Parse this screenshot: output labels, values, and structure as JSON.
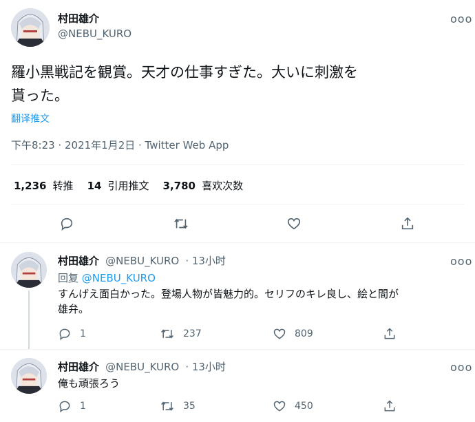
{
  "main_tweet": {
    "name": "村田雄介",
    "handle": "@NEBU_KURO",
    "text_line1": "羅小黒戦記を観賞。天才の仕事すぎた。大いに刺激を",
    "text_line2": "貰った。",
    "translate": "翻译推文",
    "timestamp": "下午8:23 · 2021年1月2日 · Twitter Web App",
    "retweets_num": "1,236",
    "retweets_label": "转推",
    "quotes_num": "14",
    "quotes_label": "引用推文",
    "likes_num": "3,780",
    "likes_label": "喜欢次数"
  },
  "replies": [
    {
      "name": "村田雄介",
      "handle": "@NEBU_KURO",
      "time": "· 13小时",
      "reply_to_label": "回复",
      "reply_to_handle": "@NEBU_KURO",
      "text_line1": "すんげえ面白かった。登場人物が皆魅力的。セリフのキレ良し、絵と間が",
      "text_line2": "雄弁。",
      "reply_count": "1",
      "retweet_count": "237",
      "like_count": "809"
    },
    {
      "name": "村田雄介",
      "handle": "@NEBU_KURO",
      "time": "· 13小时",
      "text_line1": "俺も頑張ろう",
      "reply_count": "1",
      "retweet_count": "35",
      "like_count": "450"
    }
  ],
  "more_label": "ooo",
  "colors": {
    "accent": "#1d9bf0",
    "secondary_text": "#536471",
    "divider": "#eff3f4"
  },
  "icons": [
    "reply-icon",
    "retweet-icon",
    "like-icon",
    "share-icon",
    "more-icon"
  ]
}
